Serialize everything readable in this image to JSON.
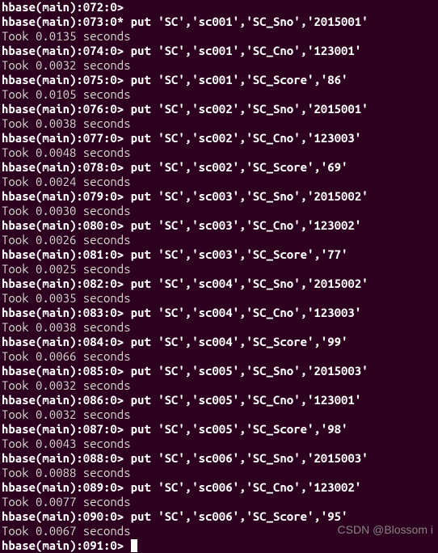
{
  "lines": [
    {
      "type": "prompt",
      "text": "hbase(main):072:0>"
    },
    {
      "type": "prompt",
      "text": "hbase(main):073:0* put 'SC','sc001','SC_Sno','2015001'"
    },
    {
      "type": "output",
      "text": "Took 0.0135 seconds"
    },
    {
      "type": "prompt",
      "text": "hbase(main):074:0> put 'SC','sc001','SC_Cno','123001'"
    },
    {
      "type": "output",
      "text": "Took 0.0032 seconds"
    },
    {
      "type": "prompt",
      "text": "hbase(main):075:0> put 'SC','sc001','SC_Score','86'"
    },
    {
      "type": "output",
      "text": "Took 0.0105 seconds"
    },
    {
      "type": "prompt",
      "text": "hbase(main):076:0> put 'SC','sc002','SC_Sno','2015001'"
    },
    {
      "type": "output",
      "text": "Took 0.0038 seconds"
    },
    {
      "type": "prompt",
      "text": "hbase(main):077:0> put 'SC','sc002','SC_Cno','123003'"
    },
    {
      "type": "output",
      "text": "Took 0.0048 seconds"
    },
    {
      "type": "prompt",
      "text": "hbase(main):078:0> put 'SC','sc002','SC_Score','69'"
    },
    {
      "type": "output",
      "text": "Took 0.0024 seconds"
    },
    {
      "type": "prompt",
      "text": "hbase(main):079:0> put 'SC','sc003','SC_Sno','2015002'"
    },
    {
      "type": "output",
      "text": "Took 0.0030 seconds"
    },
    {
      "type": "prompt",
      "text": "hbase(main):080:0> put 'SC','sc003','SC_Cno','123002'"
    },
    {
      "type": "output",
      "text": "Took 0.0026 seconds"
    },
    {
      "type": "prompt",
      "text": "hbase(main):081:0> put 'SC','sc003','SC_Score','77'"
    },
    {
      "type": "output",
      "text": "Took 0.0025 seconds"
    },
    {
      "type": "prompt",
      "text": "hbase(main):082:0> put 'SC','sc004','SC_Sno','2015002'"
    },
    {
      "type": "output",
      "text": "Took 0.0035 seconds"
    },
    {
      "type": "prompt",
      "text": "hbase(main):083:0> put 'SC','sc004','SC_Cno','123003'"
    },
    {
      "type": "output",
      "text": "Took 0.0038 seconds"
    },
    {
      "type": "prompt",
      "text": "hbase(main):084:0> put 'SC','sc004','SC_Score','99'"
    },
    {
      "type": "output",
      "text": "Took 0.0066 seconds"
    },
    {
      "type": "prompt",
      "text": "hbase(main):085:0> put 'SC','sc005','SC_Sno','2015003'"
    },
    {
      "type": "output",
      "text": "Took 0.0032 seconds"
    },
    {
      "type": "prompt",
      "text": "hbase(main):086:0> put 'SC','sc005','SC_Cno','123001'"
    },
    {
      "type": "output",
      "text": "Took 0.0032 seconds"
    },
    {
      "type": "prompt",
      "text": "hbase(main):087:0> put 'SC','sc005','SC_Score','98'"
    },
    {
      "type": "output",
      "text": "Took 0.0043 seconds"
    },
    {
      "type": "prompt",
      "text": "hbase(main):088:0> put 'SC','sc006','SC_Sno','2015003'"
    },
    {
      "type": "output",
      "text": "Took 0.0088 seconds"
    },
    {
      "type": "prompt",
      "text": "hbase(main):089:0> put 'SC','sc006','SC_Cno','123002'"
    },
    {
      "type": "output",
      "text": "Took 0.0077 seconds"
    },
    {
      "type": "prompt",
      "text": "hbase(main):090:0> put 'SC','sc006','SC_Score','95'"
    },
    {
      "type": "output",
      "text": "Took 0.0067 seconds"
    },
    {
      "type": "prompt-cursor",
      "text": "hbase(main):091:0> "
    }
  ],
  "watermark": "CSDN @Blossom i"
}
